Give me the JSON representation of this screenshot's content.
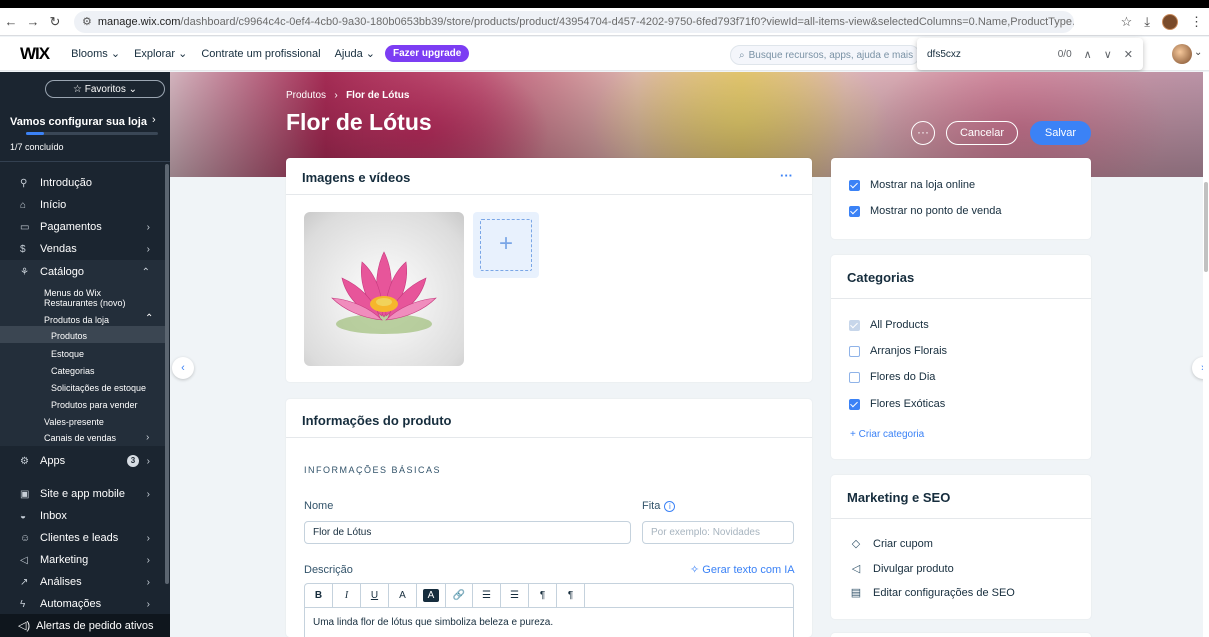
{
  "browser": {
    "url_host": "manage.wix.com",
    "url_path": "/dashboard/c9964c4c-0ef4-4cb0-9a30-180b0653bb39/store/products/product/43954704-d457-4202-9750-6fed793f71f0?viewId=all-items-view&selectedColumns=0.Name,ProductType,ProductSku,ComparePrice,ProductInventoryStatus..."
  },
  "header": {
    "logo": "WIX",
    "site_name": "Blooms",
    "explore": "Explorar",
    "hire": "Contrate um profissional",
    "help": "Ajuda",
    "upgrade": "Fazer upgrade",
    "search_placeholder": "Busque recursos, apps, ajuda e mais"
  },
  "find_bar": {
    "query": "dfs5cxz",
    "count": "0/0"
  },
  "sidebar": {
    "favorites": "☆ Favoritos",
    "setup_title": "Vamos configurar sua loja",
    "setup_progress": 0.14,
    "setup_done": "1/7 concluído",
    "items": [
      {
        "label": "Introdução"
      },
      {
        "label": "Início"
      },
      {
        "label": "Pagamentos"
      },
      {
        "label": "Vendas"
      },
      {
        "label": "Catálogo"
      }
    ],
    "catalog_sub": {
      "restaurants": "Menus do Wix Restaurantes (novo)",
      "store_products": "Produtos da loja",
      "products": "Produtos",
      "stock": "Estoque",
      "categories": "Categorias",
      "stock_requests": "Solicitações de estoque",
      "sell_products": "Produtos para vender",
      "gift_cards": "Vales-presente",
      "sales_channels": "Canais de vendas"
    },
    "apps": "Apps",
    "apps_badge": "3",
    "items2": [
      {
        "label": "Site e app mobile"
      },
      {
        "label": "Inbox"
      },
      {
        "label": "Clientes e leads"
      },
      {
        "label": "Marketing"
      },
      {
        "label": "Análises"
      },
      {
        "label": "Automações"
      }
    ],
    "bottom": "Alertas de pedido ativos"
  },
  "page": {
    "breadcrumb_root": "Produtos",
    "breadcrumb_sep": "›",
    "breadcrumb_current": "Flor de Lótus",
    "title": "Flor de Lótus",
    "more": "···",
    "cancel": "Cancelar",
    "save": "Salvar"
  },
  "media_card": {
    "title": "Imagens e vídeos",
    "more": "···",
    "add": "+"
  },
  "info_card": {
    "title": "Informações do produto",
    "section": "INFORMAÇÕES BÁSICAS",
    "name_label": "Nome",
    "name_value": "Flor de Lótus",
    "ribbon_label": "Fita",
    "ribbon_placeholder": "Por exemplo: Novidades",
    "desc_label": "Descrição",
    "ai_link": "Gerar texto com IA",
    "toolbar": [
      "B",
      "I",
      "U",
      "A",
      "A",
      "🔗",
      "☰",
      "☰",
      "¶",
      "¶"
    ],
    "description": "Uma linda flor de lótus que simboliza beleza e pureza."
  },
  "visibility_card": {
    "show_online": "Mostrar na loja online",
    "show_pos": "Mostrar no ponto de venda"
  },
  "categories_card": {
    "title": "Categorias",
    "items": [
      {
        "label": "All Products",
        "state": "disabled"
      },
      {
        "label": "Arranjos Florais",
        "state": "off"
      },
      {
        "label": "Flores do Dia",
        "state": "off"
      },
      {
        "label": "Flores Exóticas",
        "state": "on"
      }
    ],
    "create": "+ Criar categoria"
  },
  "marketing_card": {
    "title": "Marketing e SEO",
    "items": [
      {
        "label": "Criar cupom",
        "icon": "coupon-icon"
      },
      {
        "label": "Divulgar produto",
        "icon": "megaphone-icon"
      },
      {
        "label": "Editar configurações de SEO",
        "icon": "seo-icon"
      }
    ]
  },
  "colors": {
    "accent": "#3b82f6",
    "upgrade": "#7c3df3",
    "sidebar_bg": "#1b2530"
  }
}
